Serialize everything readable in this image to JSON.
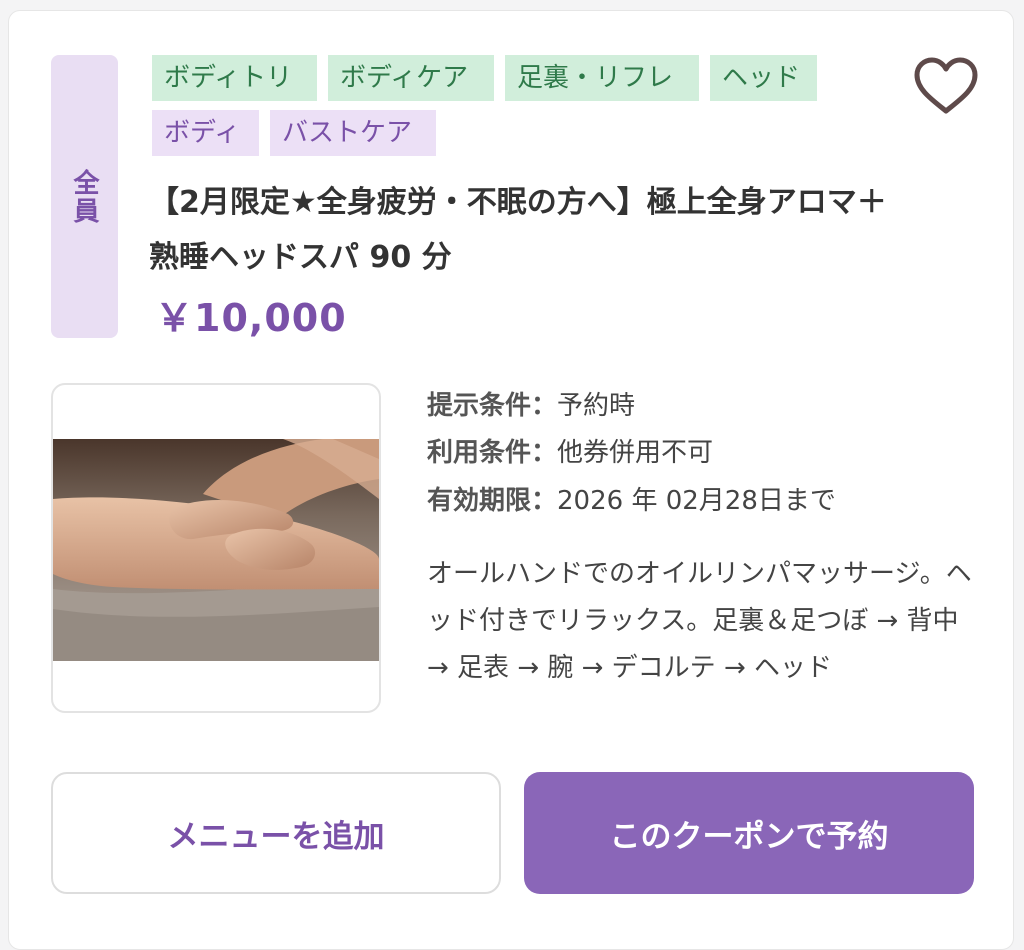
{
  "coupon": {
    "target_badge": "全員",
    "tags": [
      {
        "label": "ボディトリ",
        "color": "green"
      },
      {
        "label": "ボディケア",
        "color": "green"
      },
      {
        "label": "足裏・リフレ",
        "color": "green"
      },
      {
        "label": "ヘッド",
        "color": "green"
      },
      {
        "label": "ボディ",
        "color": "purple"
      },
      {
        "label": "バストケア",
        "color": "purple"
      }
    ],
    "title": "【2月限定★全身疲労・不眠の方へ】極上全身アロマ＋熟睡ヘッドスパ 90 分",
    "price": "￥10,000",
    "conditions": [
      {
        "label": "提示条件：",
        "value": "予約時"
      },
      {
        "label": "利用条件：",
        "value": "他券併用不可"
      },
      {
        "label": "有効期限：",
        "value": "2026 年 02月28日まで"
      }
    ],
    "description": "オールハンドでのオイルリンパマッサージ。ヘッド付きでリラックス。足裏＆足つぼ → 背中 → 足表 → 腕 → デコルテ → ヘッド",
    "favorite_icon": "heart-outline-icon",
    "image_subject": "massage-photo"
  },
  "actions": {
    "add_menu_label": "メニューを追加",
    "reserve_label": "このクーポンで予約"
  },
  "colors": {
    "accent": "#7a51a8",
    "button_primary": "#8a66b8",
    "tag_green_bg": "#d1eedb",
    "tag_purple_bg": "#ece0f6",
    "heart": "#5e4a4a"
  }
}
